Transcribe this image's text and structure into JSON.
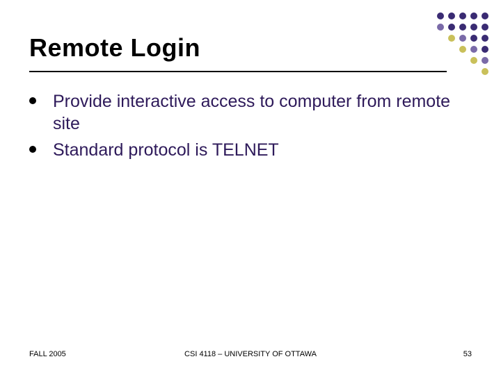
{
  "title": "Remote Login",
  "bullets": [
    "Provide interactive access to computer from remote site",
    "Standard protocol is TELNET"
  ],
  "footer": {
    "left": "FALL 2005",
    "center": "CSI 4118 – UNIVERSITY OF OTTAWA",
    "right": "53"
  },
  "deco": {
    "rows": [
      [
        "#3a2b73",
        "#3a2b73",
        "#3a2b73",
        "#3a2b73",
        "#3a2b73"
      ],
      [
        "#7a6aa8",
        "#3a2b73",
        "#3a2b73",
        "#3a2b73",
        "#3a2b73"
      ],
      [
        "#c9c05a",
        "#7a6aa8",
        "#3a2b73",
        "#3a2b73"
      ],
      [
        "#c9c05a",
        "#7a6aa8",
        "#3a2b73"
      ],
      [
        "#c9c05a",
        "#7a6aa8"
      ],
      [
        "#c9c05a"
      ]
    ]
  }
}
